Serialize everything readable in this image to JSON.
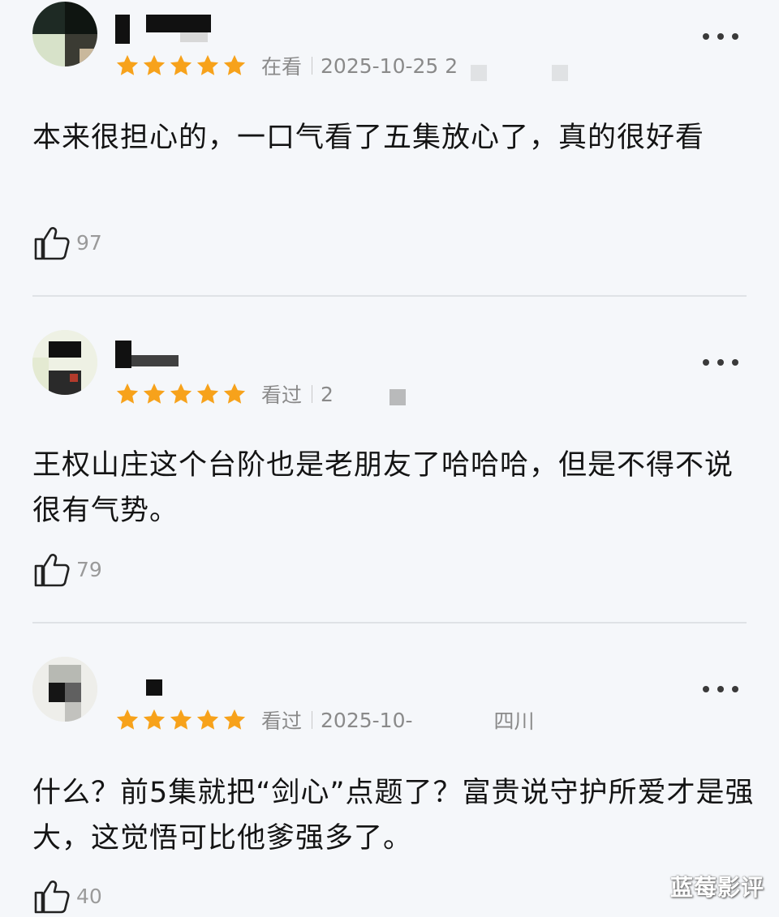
{
  "colors": {
    "star": "#f7a21b",
    "meta_text": "#8a8a8a",
    "background": "#f5f7fa"
  },
  "icons": {
    "more": "more-dots-icon",
    "star": "star-icon",
    "like": "thumbs-up-icon"
  },
  "comments": [
    {
      "rating": 5,
      "status": "在看",
      "date": "2025-10-25 2",
      "text": "本来很担心的，一口气看了五集放心了，真的很好看",
      "likes": "97"
    },
    {
      "rating": 5,
      "status": "看过",
      "date": "2",
      "text": "王权山庄这个台阶也是老朋友了哈哈哈，但是不得不说很有气势。",
      "likes": "79"
    },
    {
      "rating": 5,
      "status": "看过",
      "date": "2025-10-",
      "location": "四川",
      "text": "什么？前5集就把“剑心”点题了？富贵说守护所爱才是强大，这觉悟可比他爹强多了。",
      "likes": "40"
    }
  ],
  "watermark": "蓝莓影评"
}
